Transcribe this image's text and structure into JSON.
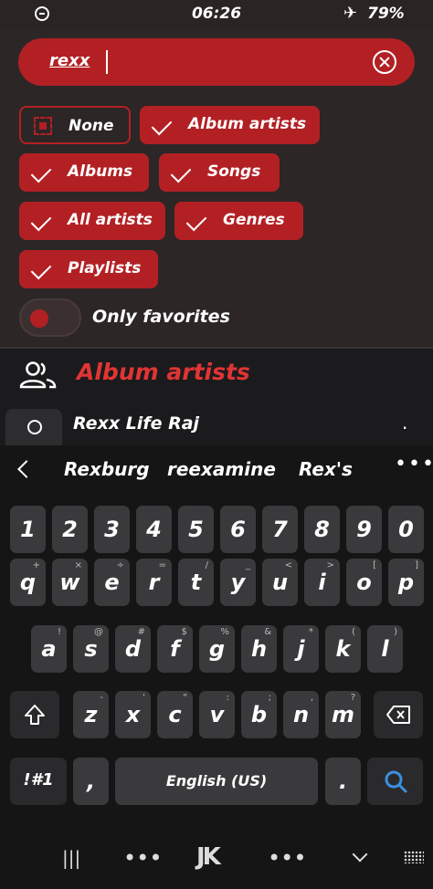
{
  "status": {
    "time": "06:26",
    "battery": "79%"
  },
  "search": {
    "value": "rexx"
  },
  "filters": {
    "none": "None",
    "album_artists": "Album artists",
    "albums": "Albums",
    "songs": "Songs",
    "all_artists": "All artists",
    "genres": "Genres",
    "playlists": "Playlists"
  },
  "favorites": {
    "label": "Only favorites"
  },
  "section": {
    "title": "Album artists"
  },
  "result": {
    "name": "Rexx Life Raj"
  },
  "suggestions": [
    "Rexburg",
    "reexamine",
    "Rex's"
  ],
  "keyboard": {
    "numbers": [
      "1",
      "2",
      "3",
      "4",
      "5",
      "6",
      "7",
      "8",
      "9",
      "0"
    ],
    "row1": [
      "q",
      "w",
      "e",
      "r",
      "t",
      "y",
      "u",
      "i",
      "o",
      "p"
    ],
    "row1_hints": [
      "+",
      "×",
      "÷",
      "=",
      "/",
      "_",
      "<",
      ">",
      "[",
      "]"
    ],
    "row2": [
      "a",
      "s",
      "d",
      "f",
      "g",
      "h",
      "j",
      "k",
      "l"
    ],
    "row2_hints": [
      "!",
      "@",
      "#",
      "$",
      "%",
      "&",
      "*",
      "(",
      ")"
    ],
    "row3": [
      "z",
      "x",
      "c",
      "v",
      "b",
      "n",
      "m"
    ],
    "row3_hints": [
      "-",
      "'",
      "\"",
      ":",
      ";",
      ",",
      "?"
    ],
    "sym": "!#1",
    "comma": ",",
    "space": "English (US)",
    "period": "."
  },
  "nav": {
    "recent": "|||",
    "dots": "•••",
    "logo": "JK",
    "dots2": "•••"
  },
  "colors": {
    "accent": "#b22024",
    "panel": "#2c2626",
    "keyboard": "#151515"
  }
}
